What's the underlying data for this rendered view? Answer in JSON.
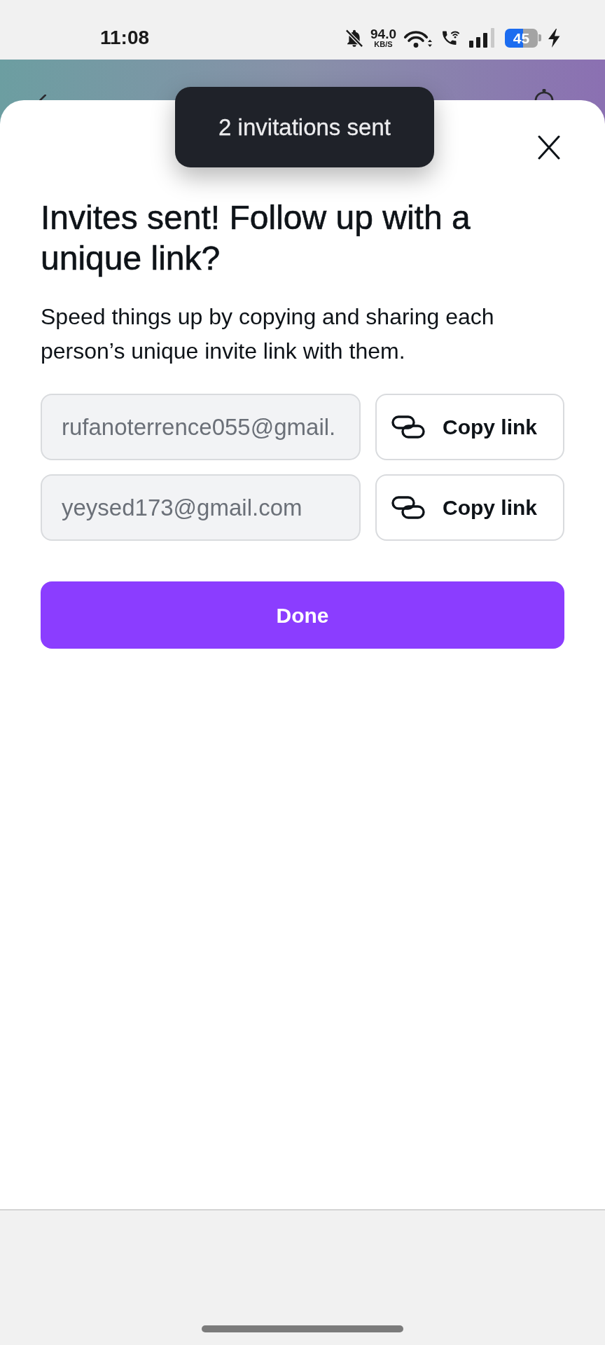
{
  "status_bar": {
    "time": "11:08",
    "network_speed": "94.0",
    "network_speed_unit": "KB/S",
    "battery": "45"
  },
  "toast": {
    "text": "2 invitations sent"
  },
  "dialog": {
    "title": "Invites sent! Follow up with a unique link?",
    "description": "Speed things up by copying and sharing each person’s unique invite link with them.",
    "invitees": [
      {
        "email": "rufanoterrence055@gmail.",
        "button": "Copy link"
      },
      {
        "email": "yeysed173@gmail.com",
        "button": "Copy link"
      }
    ],
    "done_button": "Done"
  }
}
